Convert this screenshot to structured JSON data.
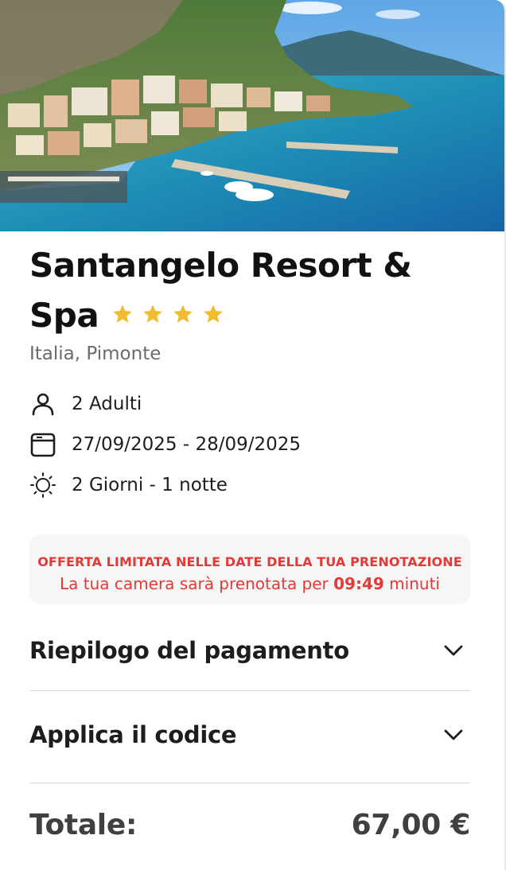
{
  "hotel": {
    "name": "Santangelo Resort & Spa",
    "star_count": 4,
    "star_color": "#f0bc32",
    "location": "Italia, Pimonte",
    "image_alt_icon": "hotel-photo-coastal-town"
  },
  "details": {
    "guests": {
      "icon": "person-icon",
      "text": "2 Adulti"
    },
    "dates": {
      "icon": "calendar-icon",
      "text": "27/09/2025 - 28/09/2025"
    },
    "duration": {
      "icon": "sun-icon",
      "text": "2 Giorni - 1 notte"
    }
  },
  "offer": {
    "headline": "OFFERTA LIMITATA NELLE DATE DELLA TUA PRENOTAZIONE",
    "text_before": "La tua camera sarà prenotata per",
    "countdown": "09:49",
    "text_after": "minuti",
    "color": "#e23a36",
    "background": "#f6f6f6"
  },
  "accordions": {
    "payment_summary": {
      "label": "Riepilogo del pagamento",
      "icon": "chevron-down-icon"
    },
    "apply_code": {
      "label": "Applica il codice",
      "icon": "chevron-down-icon"
    }
  },
  "total": {
    "label": "Totale:",
    "value": "67,00 €"
  }
}
